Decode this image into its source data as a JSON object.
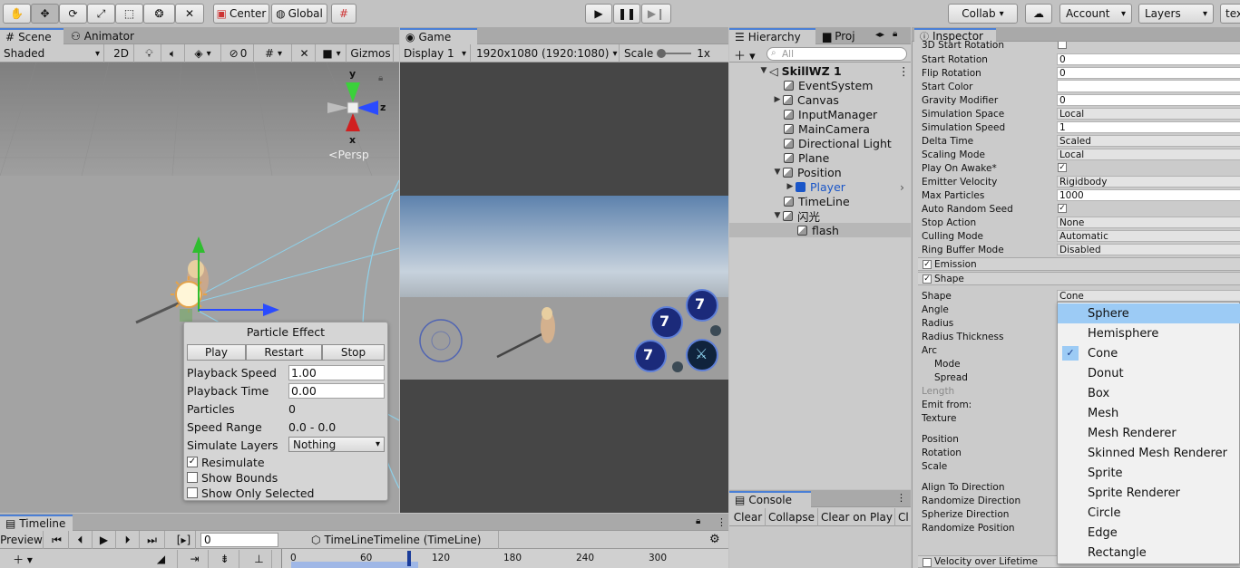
{
  "toolbar": {
    "center_label": "Center",
    "global_label": "Global",
    "collab_label": "Collab",
    "account_label": "Account",
    "layers_label": "Layers",
    "layout_label": "tex"
  },
  "scene": {
    "tab_scene": "Scene",
    "tab_animator": "Animator",
    "shading_mode": "Shaded",
    "mode_2d": "2D",
    "hidden_count": "0",
    "gizmos_label": "Gizmos",
    "persp_label": "Persp",
    "axis_y": "y",
    "axis_z": "z",
    "axis_x": "x"
  },
  "game": {
    "tab": "Game",
    "display": "Display 1",
    "resolution": "1920x1080 (1920:1080)",
    "scale_label": "Scale",
    "scale_value": "1x",
    "skill_number": "7"
  },
  "particle_effect": {
    "title": "Particle Effect",
    "play": "Play",
    "restart": "Restart",
    "stop": "Stop",
    "playback_speed_label": "Playback Speed",
    "playback_speed_value": "1.00",
    "playback_time_label": "Playback Time",
    "playback_time_value": "0.00",
    "particles_label": "Particles",
    "particles_value": "0",
    "speed_range_label": "Speed Range",
    "speed_range_value": "0.0 - 0.0",
    "simulate_layers_label": "Simulate Layers",
    "simulate_layers_value": "Nothing",
    "resimulate": "Resimulate",
    "show_bounds": "Show Bounds",
    "show_only_selected": "Show Only Selected"
  },
  "hierarchy": {
    "tab": "Hierarchy",
    "tab_project": "Proj",
    "search_placeholder": "All",
    "items": [
      {
        "label": "SkillWZ 1"
      },
      {
        "label": "EventSystem"
      },
      {
        "label": "Canvas"
      },
      {
        "label": "InputManager"
      },
      {
        "label": "MainCamera"
      },
      {
        "label": "Directional Light"
      },
      {
        "label": "Plane"
      },
      {
        "label": "Position"
      },
      {
        "label": "Player"
      },
      {
        "label": "TimeLine"
      },
      {
        "label": "闪光"
      },
      {
        "label": "flash"
      }
    ]
  },
  "console": {
    "tab": "Console",
    "clear": "Clear",
    "collapse": "Collapse",
    "clear_on_play": "Clear on Play",
    "cut": "Cl"
  },
  "inspector": {
    "tab": "Inspector",
    "rows": [
      {
        "label": "3D Start Rotation",
        "value": ""
      },
      {
        "label": "Start Rotation",
        "value": "0"
      },
      {
        "label": "Flip Rotation",
        "value": "0"
      },
      {
        "label": "Start Color",
        "value": ""
      },
      {
        "label": "Gravity Modifier",
        "value": "0"
      },
      {
        "label": "Simulation Space",
        "value": "Local"
      },
      {
        "label": "Simulation Speed",
        "value": "1"
      },
      {
        "label": "Delta Time",
        "value": "Scaled"
      },
      {
        "label": "Scaling Mode",
        "value": "Local"
      },
      {
        "label": "Play On Awake*",
        "value": ""
      },
      {
        "label": "Emitter Velocity",
        "value": "Rigidbody"
      },
      {
        "label": "Max Particles",
        "value": "1000"
      },
      {
        "label": "Auto Random Seed",
        "value": ""
      },
      {
        "label": "Stop Action",
        "value": "None"
      },
      {
        "label": "Culling Mode",
        "value": "Automatic"
      },
      {
        "label": "Ring Buffer Mode",
        "value": "Disabled"
      }
    ],
    "section_emission": "Emission",
    "section_shape": "Shape",
    "shape_label": "Shape",
    "shape_value": "Cone",
    "shape_rows": [
      "Angle",
      "Radius",
      "Radius Thickness",
      "Arc",
      "Mode",
      "Spread",
      "Length",
      "Emit from:",
      "Texture",
      "Position",
      "Rotation",
      "Scale",
      "Align To Direction",
      "Randomize Direction",
      "Spherize Direction",
      "Randomize Position"
    ],
    "section_velocity": "Velocity over Lifetime"
  },
  "shape_dropdown": {
    "options": [
      "Sphere",
      "Hemisphere",
      "Cone",
      "Donut",
      "Box",
      "Mesh",
      "Mesh Renderer",
      "Skinned Mesh Renderer",
      "Sprite",
      "Sprite Renderer",
      "Circle",
      "Edge",
      "Rectangle"
    ],
    "selected": "Cone",
    "highlighted": "Sphere"
  },
  "timeline": {
    "tab": "Timeline",
    "preview": "Preview",
    "frame": "0",
    "asset": "TimeLineTimeline (TimeLine)",
    "ticks": [
      "0",
      "60",
      "120",
      "180",
      "240",
      "300"
    ]
  },
  "colors": {
    "accent": "#4a7fd6",
    "selection": "#9ccbf5",
    "player_blue": "#1a56c8"
  }
}
